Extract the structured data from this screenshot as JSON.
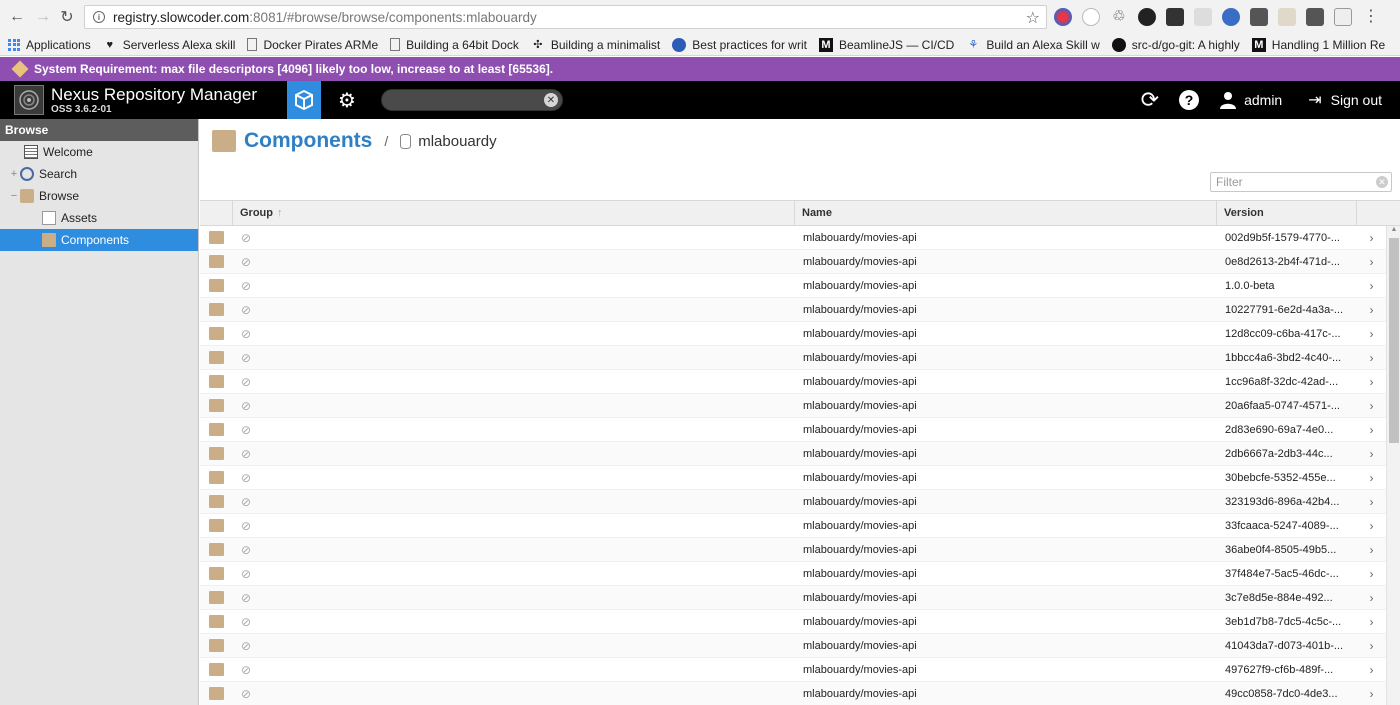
{
  "browser": {
    "url_host": "registry.slowcoder.com",
    "url_rest": ":8081/#browse/browse/components:mlabouardy",
    "bookmarks": [
      {
        "label": "Applications",
        "icon": "apps-grid-icon"
      },
      {
        "label": "Serverless Alexa skill",
        "icon": "heart-icon"
      },
      {
        "label": "Docker Pirates ARMe",
        "icon": "page-icon"
      },
      {
        "label": "Building a 64bit Dock",
        "icon": "page-icon"
      },
      {
        "label": "Building a minimalist",
        "icon": "puzzle-icon"
      },
      {
        "label": "Best practices for writ",
        "icon": "globe-icon"
      },
      {
        "label": "BeamlineJS — CI/CD",
        "icon": "medium-icon"
      },
      {
        "label": "Build an Alexa Skill w",
        "icon": "butterfly-icon"
      },
      {
        "label": "src-d/go-git: A highly",
        "icon": "github-icon"
      },
      {
        "label": "Handling 1 Million Re",
        "icon": "medium-icon"
      }
    ]
  },
  "system_banner": "System Requirement: max file descriptors [4096] likely too low, increase to at least [65536].",
  "header": {
    "product_name": "Nexus Repository Manager",
    "version": "OSS 3.6.2-01",
    "user": "admin",
    "sign_out": "Sign out"
  },
  "sidebar": {
    "title": "Browse",
    "items": [
      {
        "label": "Welcome",
        "icon": "welcome-icon"
      },
      {
        "label": "Search",
        "icon": "search-icon"
      },
      {
        "label": "Browse",
        "icon": "database-icon"
      },
      {
        "label": "Assets",
        "icon": "assets-icon"
      },
      {
        "label": "Components",
        "icon": "component-icon"
      }
    ]
  },
  "main": {
    "title": "Components",
    "repository": "mlabouardy",
    "filter_placeholder": "Filter",
    "columns": {
      "group": "Group",
      "name": "Name",
      "version": "Version"
    },
    "rows": [
      {
        "name": "mlabouardy/movies-api",
        "version": "002d9b5f-1579-4770-..."
      },
      {
        "name": "mlabouardy/movies-api",
        "version": "0e8d2613-2b4f-471d-..."
      },
      {
        "name": "mlabouardy/movies-api",
        "version": "1.0.0-beta"
      },
      {
        "name": "mlabouardy/movies-api",
        "version": "10227791-6e2d-4a3a-..."
      },
      {
        "name": "mlabouardy/movies-api",
        "version": "12d8cc09-c6ba-417c-..."
      },
      {
        "name": "mlabouardy/movies-api",
        "version": "1bbcc4a6-3bd2-4c40-..."
      },
      {
        "name": "mlabouardy/movies-api",
        "version": "1cc96a8f-32dc-42ad-..."
      },
      {
        "name": "mlabouardy/movies-api",
        "version": "20a6faa5-0747-4571-..."
      },
      {
        "name": "mlabouardy/movies-api",
        "version": "2d83e690-69a7-4e0..."
      },
      {
        "name": "mlabouardy/movies-api",
        "version": "2db6667a-2db3-44c..."
      },
      {
        "name": "mlabouardy/movies-api",
        "version": "30bebcfe-5352-455e..."
      },
      {
        "name": "mlabouardy/movies-api",
        "version": "323193d6-896a-42b4..."
      },
      {
        "name": "mlabouardy/movies-api",
        "version": "33fcaaca-5247-4089-..."
      },
      {
        "name": "mlabouardy/movies-api",
        "version": "36abe0f4-8505-49b5..."
      },
      {
        "name": "mlabouardy/movies-api",
        "version": "37f484e7-5ac5-46dc-..."
      },
      {
        "name": "mlabouardy/movies-api",
        "version": "3c7e8d5e-884e-492..."
      },
      {
        "name": "mlabouardy/movies-api",
        "version": "3eb1d7b8-7dc5-4c5c-..."
      },
      {
        "name": "mlabouardy/movies-api",
        "version": "41043da7-d073-401b-..."
      },
      {
        "name": "mlabouardy/movies-api",
        "version": "497627f9-cf6b-489f-..."
      },
      {
        "name": "mlabouardy/movies-api",
        "version": "49cc0858-7dc0-4de3..."
      }
    ]
  }
}
